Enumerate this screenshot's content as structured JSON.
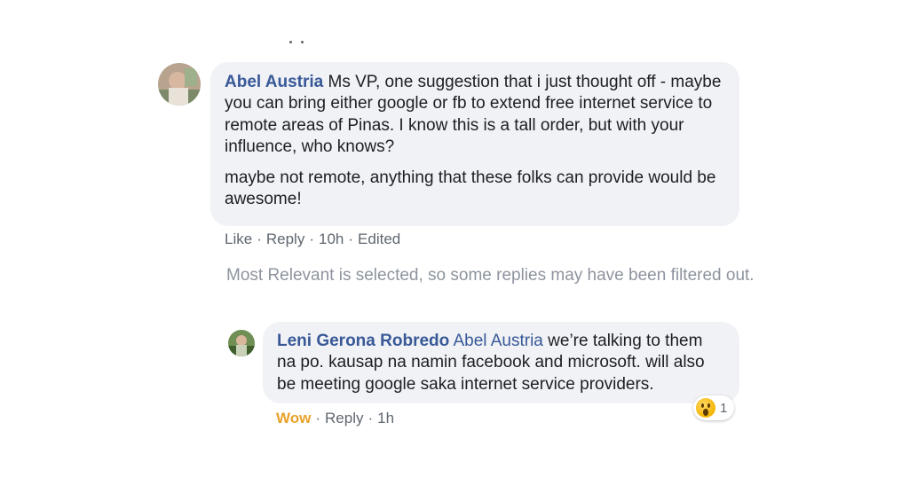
{
  "comment": {
    "author": "Abel Austria",
    "paragraphs": [
      "Ms VP, one suggestion that i just thought off - maybe you can bring either google or fb to extend free internet service to remote areas of Pinas. I know this is a tall order, but with your influence, who knows?",
      "maybe not remote, anything that these folks can provide would be awesome!"
    ],
    "actions": {
      "like": "Like",
      "reply": "Reply",
      "time": "10h",
      "edited": "Edited",
      "separator": "·"
    }
  },
  "filter_notice": "Most Relevant is selected, so some replies may have been filtered out.",
  "reply": {
    "author": "Leni Gerona Robredo",
    "mention": "Abel Austria",
    "text": "we’re talking to them na po. kausap na namin facebook and microsoft. will also be meeting google saka internet service providers.",
    "actions": {
      "reaction_label": "Wow",
      "reply": "Reply",
      "time": "1h",
      "separator": "·"
    },
    "reaction_badge": {
      "icon": "wow-emoji-icon",
      "count": "1"
    }
  },
  "colors": {
    "author_link": "#385898",
    "bubble": "#f0f2f5",
    "meta_text": "#606770",
    "notice_text": "#8d949e",
    "wow_accent": "#e8a22a"
  }
}
